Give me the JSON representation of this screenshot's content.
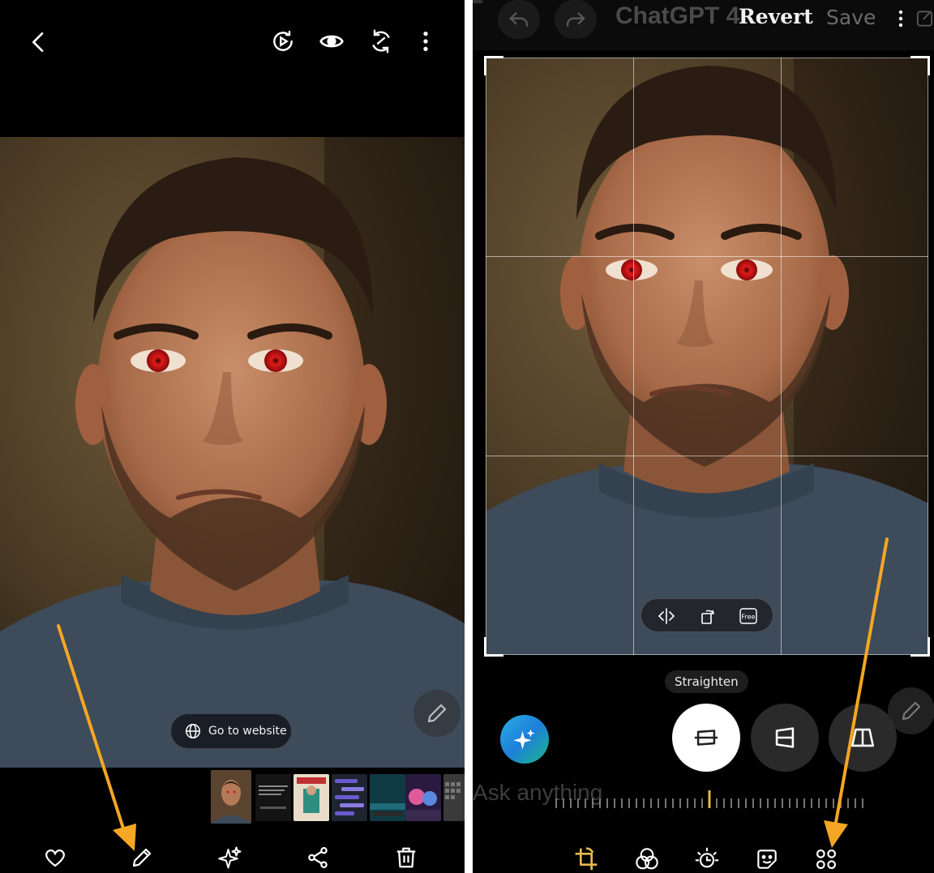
{
  "left_screen": {
    "topbar": {
      "icons": [
        "back-icon",
        "motion-play-icon",
        "eye-icon",
        "remaster-icon",
        "more-vert-icon"
      ]
    },
    "photo": {
      "subject": "portrait"
    },
    "go_to_website_label": "Go to website",
    "thumbnails": [
      {
        "kind": "portrait"
      },
      {
        "kind": "text-dark",
        "text": "Which one has the strength to retouch faces..."
      },
      {
        "kind": "magazine",
        "text": "DESIGN"
      },
      {
        "kind": "chat"
      },
      {
        "kind": "teal"
      },
      {
        "kind": "colorful"
      },
      {
        "kind": "keyboard"
      }
    ],
    "bottombar": {
      "icons": [
        "heart-icon",
        "pencil-edit-icon",
        "sparkle-ai-icon",
        "share-icon",
        "trash-icon"
      ]
    }
  },
  "right_screen": {
    "topbar": {
      "ghost_title": "ChatGPT 4",
      "revert_label": "Revert",
      "save_label": "Save",
      "icons": [
        "undo-icon",
        "redo-icon",
        "more-vert-icon",
        "edit-square-icon"
      ]
    },
    "crop_tools": {
      "icons": [
        "flip-icon",
        "rotate-icon",
        "free-aspect-icon"
      ],
      "free_label": "Free"
    },
    "straighten_label": "Straighten",
    "modes": [
      "straighten-icon",
      "vertical-perspective-icon",
      "horizontal-perspective-icon"
    ],
    "ask_ghost_text": "Ask anything",
    "bottombar": {
      "icons": [
        "crop-rotate-icon",
        "filters-icon",
        "brightness-icon",
        "sticker-icon",
        "more-tools-icon"
      ]
    }
  },
  "colors": {
    "annotation_arrow": "#F5A623",
    "background": "#000000",
    "red_eye": "#D01818",
    "ruler_marker": "#E8B84A"
  }
}
